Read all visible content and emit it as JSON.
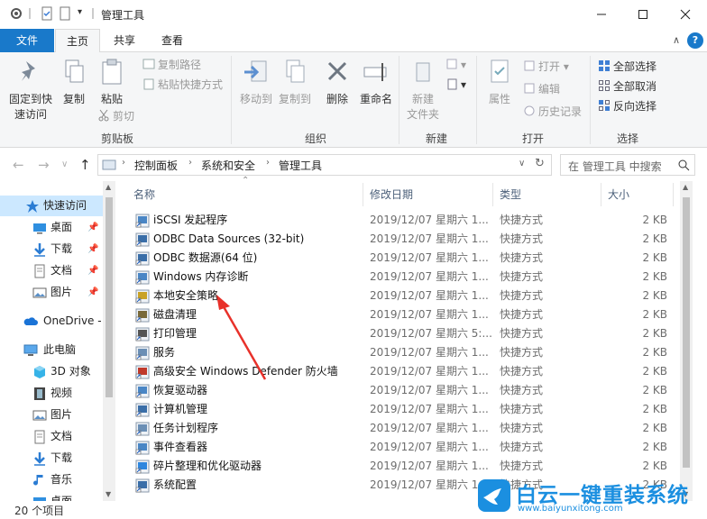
{
  "window": {
    "title": "管理工具"
  },
  "ribbon_tabs": [
    {
      "label": "文件"
    },
    {
      "label": "主页"
    },
    {
      "label": "共享"
    },
    {
      "label": "查看"
    }
  ],
  "ribbon": {
    "clipboard": {
      "pin": "固定到快",
      "pin2": "速访问",
      "copy": "复制",
      "paste": "粘贴",
      "copy_path": "复制路径",
      "paste_shortcut": "粘贴快捷方式",
      "cut": "剪切",
      "group": "剪贴板"
    },
    "organize": {
      "move_to": "移动到",
      "copy_to": "复制到",
      "delete": "删除",
      "rename": "重命名",
      "group": "组织"
    },
    "new": {
      "new_folder": "新建",
      "new_folder2": "文件夹",
      "group": "新建"
    },
    "open": {
      "properties": "属性",
      "open": "打开",
      "edit": "编辑",
      "history": "历史记录",
      "group": "打开"
    },
    "select": {
      "select_all": "全部选择",
      "select_none": "全部取消",
      "invert": "反向选择",
      "group": "选择"
    }
  },
  "address": {
    "crumbs": [
      "控制面板",
      "系统和安全",
      "管理工具"
    ],
    "search_placeholder": "在 管理工具 中搜索"
  },
  "nav": {
    "items": [
      {
        "label": "快速访问"
      },
      {
        "label": "桌面"
      },
      {
        "label": "下载"
      },
      {
        "label": "文档"
      },
      {
        "label": "图片"
      },
      {
        "label": "OneDrive -"
      },
      {
        "label": "此电脑"
      },
      {
        "label": "3D 对象"
      },
      {
        "label": "视频"
      },
      {
        "label": "图片"
      },
      {
        "label": "文档"
      },
      {
        "label": "下载"
      },
      {
        "label": "音乐"
      },
      {
        "label": "桌面"
      }
    ]
  },
  "columns": {
    "name": "名称",
    "date": "修改日期",
    "type": "类型",
    "size": "大小"
  },
  "files": [
    {
      "name": "iSCSI 发起程序",
      "date": "2019/12/07 星期六 1...",
      "type": "快捷方式",
      "size": "2 KB"
    },
    {
      "name": "ODBC Data Sources (32-bit)",
      "date": "2019/12/07 星期六 1...",
      "type": "快捷方式",
      "size": "2 KB"
    },
    {
      "name": "ODBC 数据源(64 位)",
      "date": "2019/12/07 星期六 1...",
      "type": "快捷方式",
      "size": "2 KB"
    },
    {
      "name": "Windows 内存诊断",
      "date": "2019/12/07 星期六 1...",
      "type": "快捷方式",
      "size": "2 KB"
    },
    {
      "name": "本地安全策略",
      "date": "2019/12/07 星期六 1...",
      "type": "快捷方式",
      "size": "2 KB"
    },
    {
      "name": "磁盘清理",
      "date": "2019/12/07 星期六 1...",
      "type": "快捷方式",
      "size": "2 KB"
    },
    {
      "name": "打印管理",
      "date": "2019/12/07 星期六 5:...",
      "type": "快捷方式",
      "size": "2 KB"
    },
    {
      "name": "服务",
      "date": "2019/12/07 星期六 1...",
      "type": "快捷方式",
      "size": "2 KB"
    },
    {
      "name": "高级安全 Windows Defender 防火墙",
      "date": "2019/12/07 星期六 1...",
      "type": "快捷方式",
      "size": "2 KB"
    },
    {
      "name": "恢复驱动器",
      "date": "2019/12/07 星期六 1...",
      "type": "快捷方式",
      "size": "2 KB"
    },
    {
      "name": "计算机管理",
      "date": "2019/12/07 星期六 1...",
      "type": "快捷方式",
      "size": "2 KB"
    },
    {
      "name": "任务计划程序",
      "date": "2019/12/07 星期六 1...",
      "type": "快捷方式",
      "size": "2 KB"
    },
    {
      "name": "事件查看器",
      "date": "2019/12/07 星期六 1...",
      "type": "快捷方式",
      "size": "2 KB"
    },
    {
      "name": "碎片整理和优化驱动器",
      "date": "2019/12/07 星期六 1...",
      "type": "快捷方式",
      "size": "2 KB"
    },
    {
      "name": "系统配置",
      "date": "2019/12/07 星期六 1...",
      "type": "快捷方式",
      "size": "2 KB"
    }
  ],
  "status": {
    "count": "20 个项目"
  },
  "watermark": {
    "text": "白云一键重装系统",
    "url": "www.baiyunxitong.com"
  },
  "colors": {
    "accent": "#1979ca",
    "selection": "#cce8ff",
    "arrow": "#e8312a",
    "watermark": "#1b8fe0"
  }
}
